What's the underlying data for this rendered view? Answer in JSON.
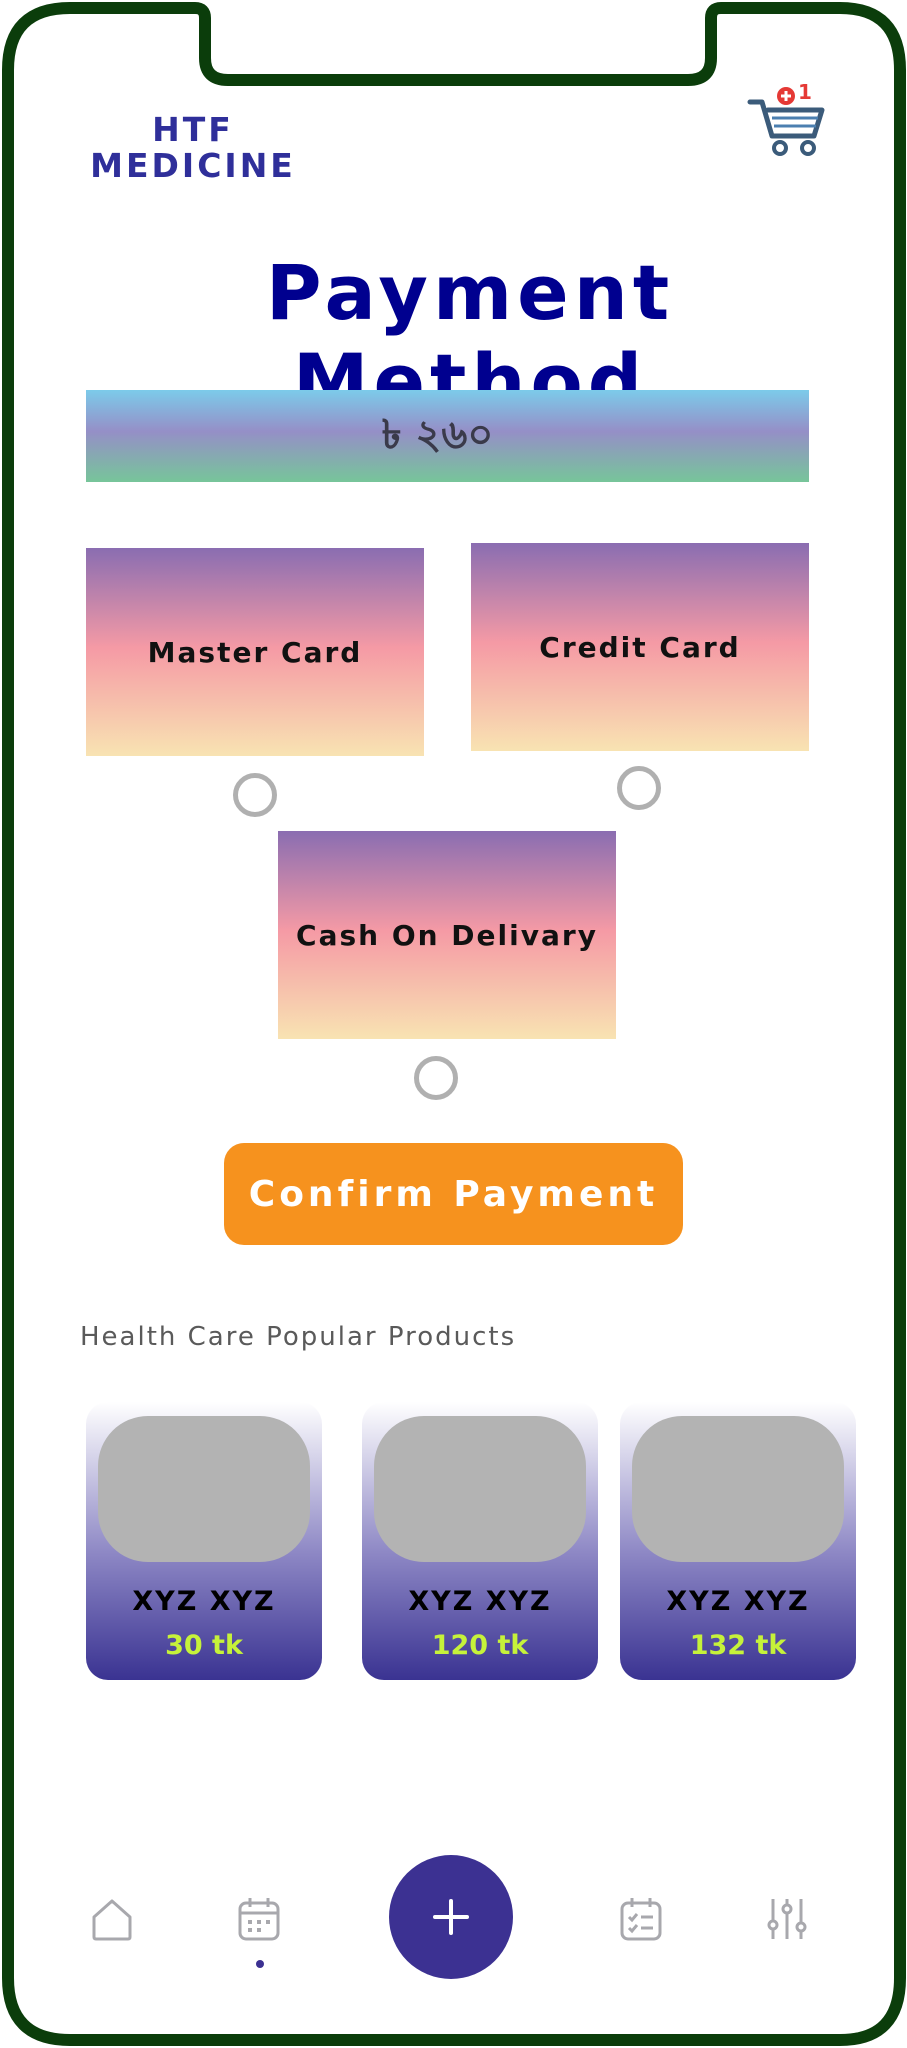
{
  "brand": {
    "line1": "HTF",
    "line2": "MEDICINE"
  },
  "cart": {
    "badge_count": "1",
    "icon": "shopping-cart-icon"
  },
  "page": {
    "title": "Payment Method"
  },
  "amount": {
    "value": "৳ ২৬০"
  },
  "payment_methods": [
    {
      "label": "Master Card",
      "selected": false
    },
    {
      "label": "Credit Card",
      "selected": false
    },
    {
      "label": "Cash On Delivary",
      "selected": false
    }
  ],
  "confirm": {
    "label": "Confirm Payment"
  },
  "popular": {
    "heading": "Health Care Popular Products",
    "products": [
      {
        "name": "XYZ XYZ",
        "price": "30 tk"
      },
      {
        "name": "XYZ XYZ",
        "price": "120 tk"
      },
      {
        "name": "XYZ XYZ",
        "price": "132 tk"
      }
    ]
  },
  "bottom_nav": {
    "items": [
      "home-icon",
      "calendar-icon",
      "add-icon",
      "checklist-icon",
      "filter-sliders-icon"
    ],
    "active_index": 1
  },
  "colors": {
    "frame": "#0b3d0b",
    "accent": "#3c3192",
    "confirm": "#f6921e",
    "price": "#c6f23a"
  }
}
